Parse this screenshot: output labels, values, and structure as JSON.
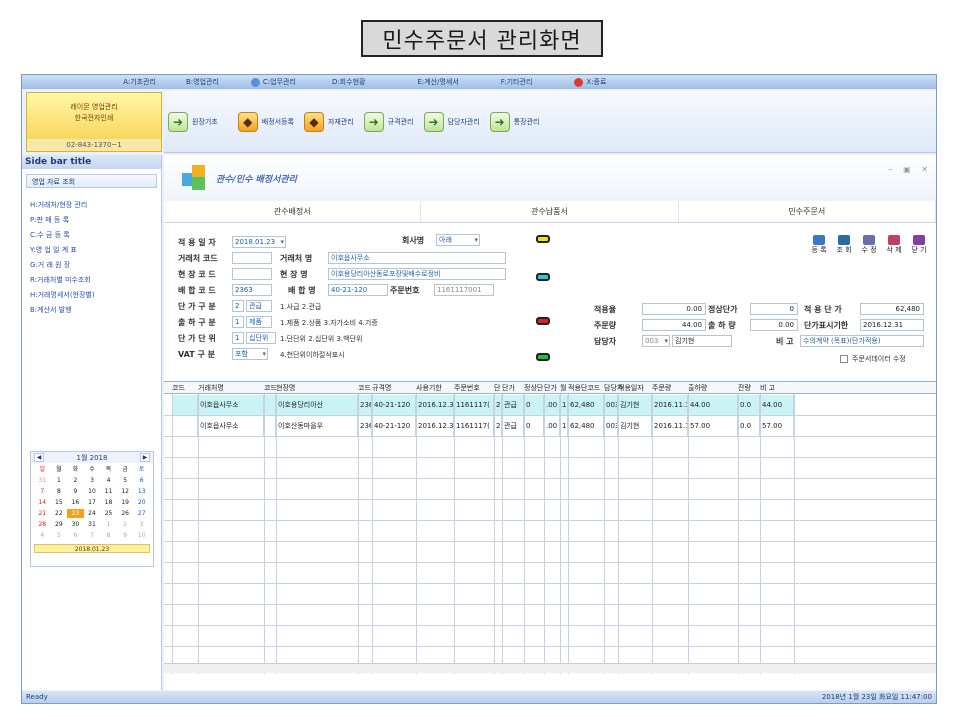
{
  "page_title": "민수주문서 관리화면",
  "menu": [
    {
      "label": "A:기초관리",
      "icon": ""
    },
    {
      "label": "B:영업관리",
      "icon": ""
    },
    {
      "label": "C:업무관리",
      "icon": "gear-icon"
    },
    {
      "label": "D:회수현황",
      "icon": ""
    },
    {
      "label": "E:계산/명세서",
      "icon": ""
    },
    {
      "label": "F:기타관리",
      "icon": ""
    },
    {
      "label": "X:종료",
      "icon": "exit-icon"
    }
  ],
  "company": {
    "name": "레이몬 영업관리",
    "sub": "한국전자인쇄",
    "phone": "02-843-1370~1"
  },
  "toolbar": [
    {
      "label": "원장기초",
      "icon": "arrow-in-icon"
    },
    {
      "label": "배정서등록",
      "icon": "cube-icon"
    },
    {
      "label": "자재관리",
      "icon": "cube-icon"
    },
    {
      "label": "규격관리",
      "icon": "arrow-in-icon"
    },
    {
      "label": "담당자관리",
      "icon": "arrow-in-icon"
    },
    {
      "label": "통장관리",
      "icon": "arrow-in-icon"
    }
  ],
  "sidebar": {
    "title": "Side bar title",
    "group": "영업 자료 조회",
    "items": [
      "H:거래처/현장 관리",
      "P:판 매 등 록",
      "C:수 금 등 록",
      "Y:영 업 일 계 표",
      "G:거 래 원 장",
      "R:거래처별 미수조회",
      "H:거래명세서(현장별)",
      "B:계산서 발행"
    ],
    "calendar": {
      "title": "1월 2018",
      "weekdays": [
        "일",
        "월",
        "화",
        "수",
        "목",
        "금",
        "토"
      ],
      "days": [
        "31",
        "1",
        "2",
        "3",
        "4",
        "5",
        "6",
        "7",
        "8",
        "9",
        "10",
        "11",
        "12",
        "13",
        "14",
        "15",
        "16",
        "17",
        "18",
        "19",
        "20",
        "21",
        "22",
        "23",
        "24",
        "25",
        "26",
        "27",
        "28",
        "29",
        "30",
        "31",
        "1",
        "2",
        "3",
        "4",
        "5",
        "6",
        "7",
        "8",
        "9",
        "10"
      ],
      "today": "2018.01.23"
    }
  },
  "work": {
    "title": "관수/민수 배정서관리",
    "win_controls": "– ▣ ✕",
    "tabs": [
      "관수배정서",
      "관수납품서",
      "민수주문서"
    ]
  },
  "form": {
    "apply_date_label": "적 용 일 자",
    "apply_date": "2018.01.23",
    "company_label": "회사명",
    "company": "아래",
    "client_code_label": "거래처 코드",
    "client_name_label": "거래처 명",
    "client_name": "이호읍사무소",
    "site_code_label": "현 장 코 드",
    "site_name_label": "현 장 명",
    "site_name": "이호용당리아산동로포장및배수로정비",
    "assign_code_label": "배 합 코 드",
    "assign_code": "2363",
    "assign_name_label": "배 합 명",
    "assign_name": "40-21-120",
    "order_no_label": "주문번호",
    "order_no": "1161117001",
    "price_type_label": "단 가 구 분",
    "price_type_code": "2",
    "price_type": "관급",
    "price_type_desc": "1.사급 2.관급",
    "ship_type_label": "출 하 구 분",
    "ship_type_code": "1",
    "ship_type": "제품",
    "ship_type_desc": "1.제품 2.상품 3.자가소비 4.기증",
    "unit_label": "단 가 단 위",
    "unit_code": "1",
    "unit": "십단위",
    "unit_desc": "1.단단위 2.십단위 3.백단위",
    "vat_label": "VAT 구 분",
    "vat": "포함",
    "vat_desc": "4.천단위이하절삭표시",
    "apply_qty_label": "적용율",
    "apply_qty": "0.00",
    "normal_price_label": "정상단가",
    "normal_price": "0",
    "apply_price_label": "적 용 단 가",
    "apply_price": "62,480",
    "order_qty_label": "주문량",
    "order_qty": "44.00",
    "ship_qty_label": "출 하 량",
    "ship_qty": "0.00",
    "price_date_label": "단가표시기한",
    "price_date": "2016.12.31",
    "manager_label": "담당자",
    "manager_code": "003",
    "manager": "김기현",
    "note_label": "비 고",
    "note": "수의계약 (목표)(단가적용)",
    "checkbox_label": "주문서데이터 수정",
    "buttons": [
      "등 록",
      "조 회",
      "수 정",
      "삭 제",
      "닫 기"
    ]
  },
  "grid": {
    "headers": [
      "코드",
      "거래처명",
      "코드",
      "현장명",
      "코드",
      "규격명",
      "사용기한",
      "주문번호",
      "단",
      "단가",
      "정상단",
      "단가",
      "월",
      "적용단코드",
      "담당자",
      "적용일자",
      "주문량",
      "출하량",
      "잔량",
      "비 고"
    ],
    "rows": [
      [
        "",
        "이호읍사무소",
        "",
        "이호용당리아산",
        "236",
        "40-21-120",
        "2016.12.3",
        "1161117(",
        "2",
        "관급",
        "0",
        ".00",
        "1",
        "62,480",
        "003",
        "김기현",
        "2016.11.1",
        "44.00",
        "0.0",
        "44.00"
      ],
      [
        "",
        "이호읍사무소",
        "",
        "이호산동마을우",
        "236",
        "40-21-120",
        "2016.12.3",
        "1161117(",
        "2",
        "관급",
        "0",
        ".00",
        "1",
        "62,480",
        "003",
        "김기현",
        "2016.11.1",
        "57.00",
        "0.0",
        "57.00"
      ]
    ]
  },
  "status": {
    "left": "Ready",
    "right": "2018년 1월 23일 화요일 11:47:00"
  }
}
